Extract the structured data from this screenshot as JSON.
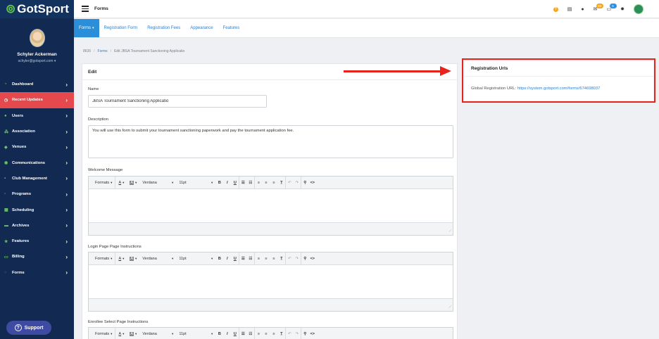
{
  "app": {
    "logo": "GotSport"
  },
  "user": {
    "name": "Schyler Ackerman",
    "email": "schyler@gotsport.com"
  },
  "sidebar": {
    "items": [
      {
        "label": "Dashboard",
        "icon": "dashboard-icon",
        "glyph": "◔",
        "active": false
      },
      {
        "label": "Recent Updates",
        "icon": "clock-icon",
        "glyph": "◷",
        "active": true
      },
      {
        "label": "Users",
        "icon": "users-icon",
        "glyph": "●",
        "active": false
      },
      {
        "label": "Association",
        "icon": "sitemap-icon",
        "glyph": "⁂",
        "active": false
      },
      {
        "label": "Venues",
        "icon": "venue-icon",
        "glyph": "◆",
        "active": false
      },
      {
        "label": "Communications",
        "icon": "megaphone-icon",
        "glyph": "◉",
        "active": false
      },
      {
        "label": "Club Management",
        "icon": "club-icon",
        "glyph": "▪",
        "active": false
      },
      {
        "label": "Programs",
        "icon": "programs-icon",
        "glyph": "▫",
        "active": false
      },
      {
        "label": "Scheduling",
        "icon": "calendar-icon",
        "glyph": "▦",
        "active": false
      },
      {
        "label": "Archives",
        "icon": "archive-icon",
        "glyph": "▬",
        "active": false
      },
      {
        "label": "Features",
        "icon": "star-icon",
        "glyph": "★",
        "active": false
      },
      {
        "label": "Billing",
        "icon": "billing-icon",
        "glyph": "▭",
        "active": false
      },
      {
        "label": "Forms",
        "icon": "forms-icon",
        "glyph": "◌",
        "active": false
      }
    ],
    "support_label": "Support"
  },
  "topbar": {
    "title": "Forms",
    "mail_badge": "99",
    "chat_badge": "6"
  },
  "subtabs": [
    {
      "label": "Forms",
      "active": true
    },
    {
      "label": "Registration Form",
      "active": false
    },
    {
      "label": "Registration Fees",
      "active": false
    },
    {
      "label": "Appearance",
      "active": false
    },
    {
      "label": "Features",
      "active": false
    }
  ],
  "breadcrumb": {
    "root": "8636",
    "forms": "Forms",
    "current": "Edit JBSA Tournament Sanctioning Applicatio"
  },
  "edit_panel": {
    "title": "Edit",
    "name_label": "Name",
    "name_value": "JBSA Tournament Sanctioning Applicatio",
    "description_label": "Description",
    "description_value": "You will use this form to submit your tournament sanctioning paperwork and pay the tournament application fee.",
    "welcome_label": "Welcome Message",
    "login_label": "Login Page Page Instructions",
    "enrollee_label": "Enrollee Select Page Instructions"
  },
  "editor_toolbar": {
    "formats": "Formats",
    "text_color": "A",
    "bg_color": "A",
    "font": "Verdana",
    "size": "11pt"
  },
  "registration_urls": {
    "title": "Registration Urls",
    "label": "Global Registration URL:",
    "url": "https://system.gotsport.com/forms/674698037"
  },
  "colors": {
    "sidebar_bg": "#122a52",
    "active_nav": "#e5484d",
    "accent_blue": "#2a8fd8",
    "annotation_red": "#e8231c"
  }
}
